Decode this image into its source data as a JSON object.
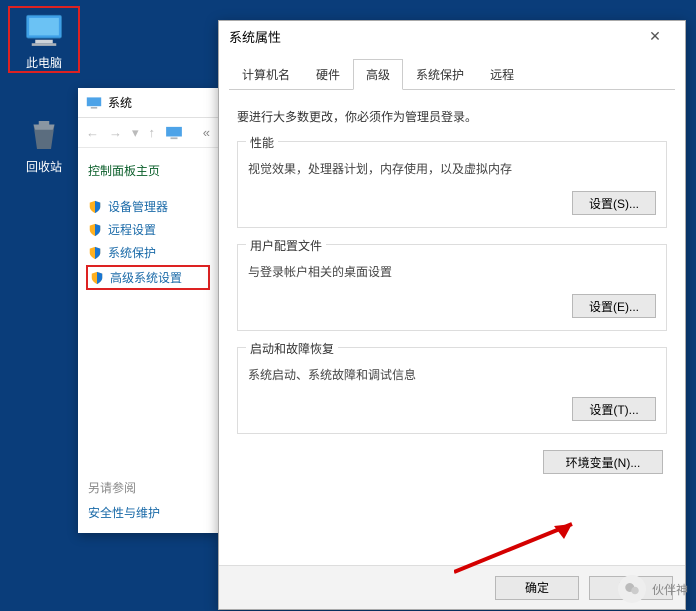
{
  "desktop": {
    "this_pc": "此电脑",
    "recycle": "回收站"
  },
  "system_window": {
    "title": "系统",
    "nav_chevrons": "«",
    "heading": "控制面板主页",
    "links": {
      "device_mgr": "设备管理器",
      "remote": "远程设置",
      "sys_protect": "系统保护",
      "advanced": "高级系统设置"
    },
    "see_also": "另请参阅",
    "security": "安全性与维护"
  },
  "props": {
    "title": "系统属性",
    "tabs": {
      "computer_name": "计算机名",
      "hardware": "硬件",
      "advanced": "高级",
      "sys_protect": "系统保护",
      "remote": "远程"
    },
    "note": "要进行大多数更改，你必须作为管理员登录。",
    "perf": {
      "legend": "性能",
      "desc": "视觉效果，处理器计划，内存使用，以及虚拟内存",
      "btn": "设置(S)..."
    },
    "profile": {
      "legend": "用户配置文件",
      "desc": "与登录帐户相关的桌面设置",
      "btn": "设置(E)..."
    },
    "startup": {
      "legend": "启动和故障恢复",
      "desc": "系统启动、系统故障和调试信息",
      "btn": "设置(T)..."
    },
    "envvar_btn": "环境变量(N)...",
    "ok": "确定",
    "cancel": "取消"
  },
  "watermark": "伙伴神"
}
